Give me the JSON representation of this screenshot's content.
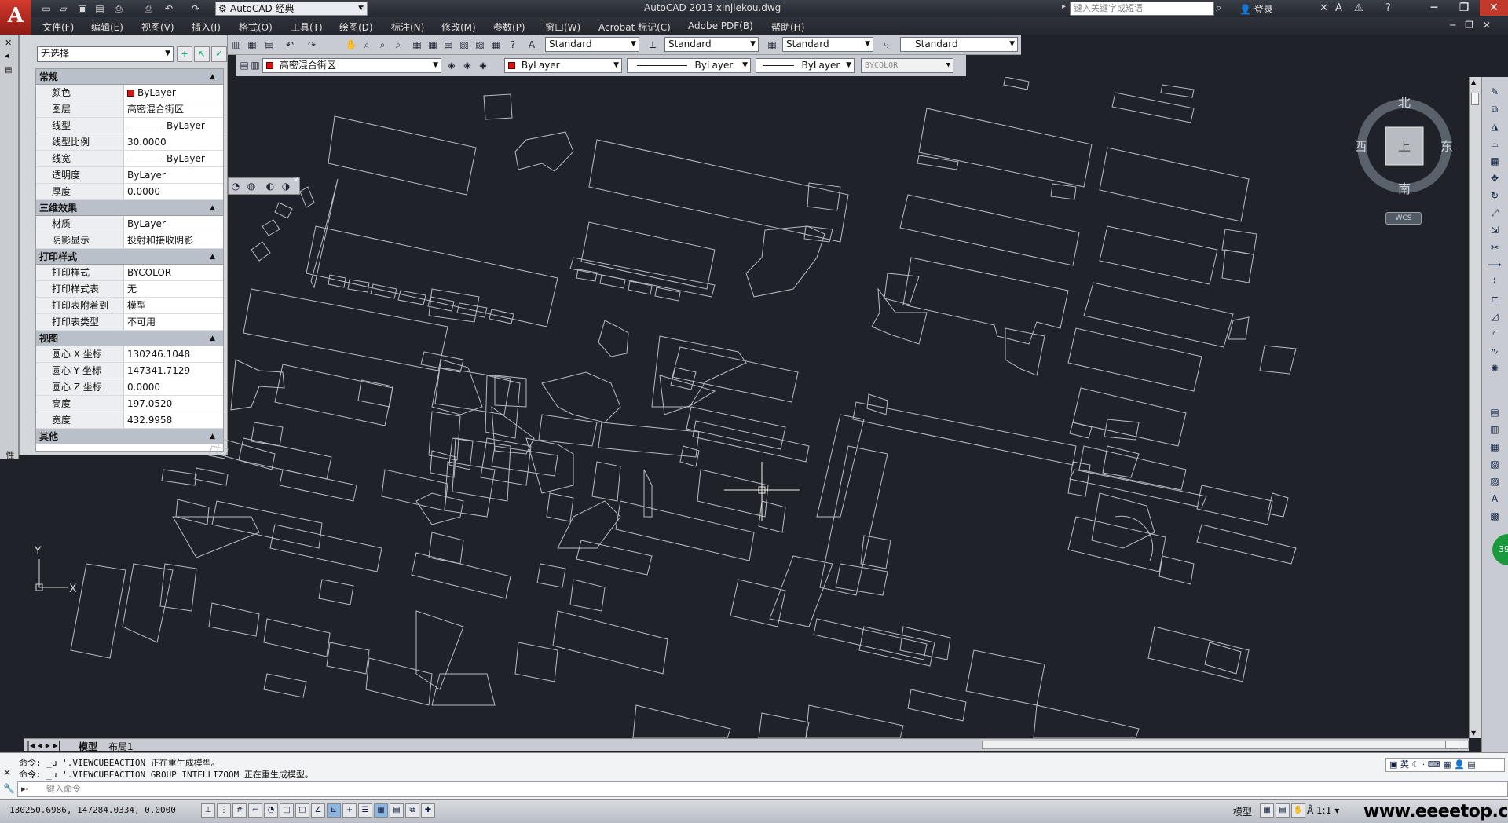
{
  "window": {
    "workspace": "AutoCAD 经典",
    "title": "AutoCAD 2013    xinjiekou.dwg",
    "search_placeholder": "键入关键字或短语",
    "login": "登录"
  },
  "menu": [
    "文件(F)",
    "编辑(E)",
    "视图(V)",
    "插入(I)",
    "格式(O)",
    "工具(T)",
    "绘图(D)",
    "标注(N)",
    "修改(M)",
    "参数(P)",
    "窗口(W)",
    "Acrobat 标记(C)",
    "Adobe PDF(B)",
    "帮助(H)"
  ],
  "styles": {
    "text_style": "Standard",
    "dim_style": "Standard",
    "table_style": "Standard",
    "multileader_style": "Standard"
  },
  "layers": {
    "current_layer": "高密混合街区",
    "color": "ByLayer",
    "linetype": "ByLayer",
    "lineweight": "ByLayer",
    "plotstyle": "BYCOLOR"
  },
  "properties": {
    "selection": "无选择",
    "groups": [
      {
        "title": "常规",
        "rows": [
          {
            "k": "颜色",
            "v": "ByLayer",
            "swatch": true
          },
          {
            "k": "图层",
            "v": "高密混合街区"
          },
          {
            "k": "线型",
            "v": "ByLayer",
            "line": true
          },
          {
            "k": "线型比例",
            "v": "30.0000"
          },
          {
            "k": "线宽",
            "v": "ByLayer",
            "line": true
          },
          {
            "k": "透明度",
            "v": "ByLayer"
          },
          {
            "k": "厚度",
            "v": "0.0000"
          }
        ]
      },
      {
        "title": "三维效果",
        "rows": [
          {
            "k": "材质",
            "v": "ByLayer"
          },
          {
            "k": "阴影显示",
            "v": "投射和接收阴影"
          }
        ]
      },
      {
        "title": "打印样式",
        "rows": [
          {
            "k": "打印样式",
            "v": "BYCOLOR"
          },
          {
            "k": "打印样式表",
            "v": "无"
          },
          {
            "k": "打印表附着到",
            "v": "模型"
          },
          {
            "k": "打印表类型",
            "v": "不可用"
          }
        ]
      },
      {
        "title": "视图",
        "rows": [
          {
            "k": "圆心 X 坐标",
            "v": "130246.1048"
          },
          {
            "k": "圆心 Y 坐标",
            "v": "147341.7129"
          },
          {
            "k": "圆心 Z 坐标",
            "v": "0.0000"
          },
          {
            "k": "高度",
            "v": "197.0520"
          },
          {
            "k": "宽度",
            "v": "432.9958"
          }
        ]
      },
      {
        "title": "其他",
        "rows": []
      }
    ],
    "palette_label": "特性"
  },
  "viewcube": {
    "north": "北",
    "south": "南",
    "east": "东",
    "west": "西",
    "face": "上",
    "wcs": "WCS"
  },
  "ucs": {
    "x": "X",
    "y": "Y"
  },
  "tabs": {
    "model": "模型",
    "layout1": "布局1"
  },
  "command": {
    "history": [
      "命令: _u '.VIEWCUBEACTION 正在重生成模型。",
      "命令: _u '.VIEWCUBEACTION GROUP INTELLIZOOM 正在重生成模型。"
    ],
    "placeholder": "键入命令",
    "right_label": "英"
  },
  "status": {
    "coords": "130250.6986, 147284.0334, 0.0000",
    "model": "模型",
    "scale": "1:1",
    "watermark": "www.eeeetop.com"
  },
  "badge": "39"
}
